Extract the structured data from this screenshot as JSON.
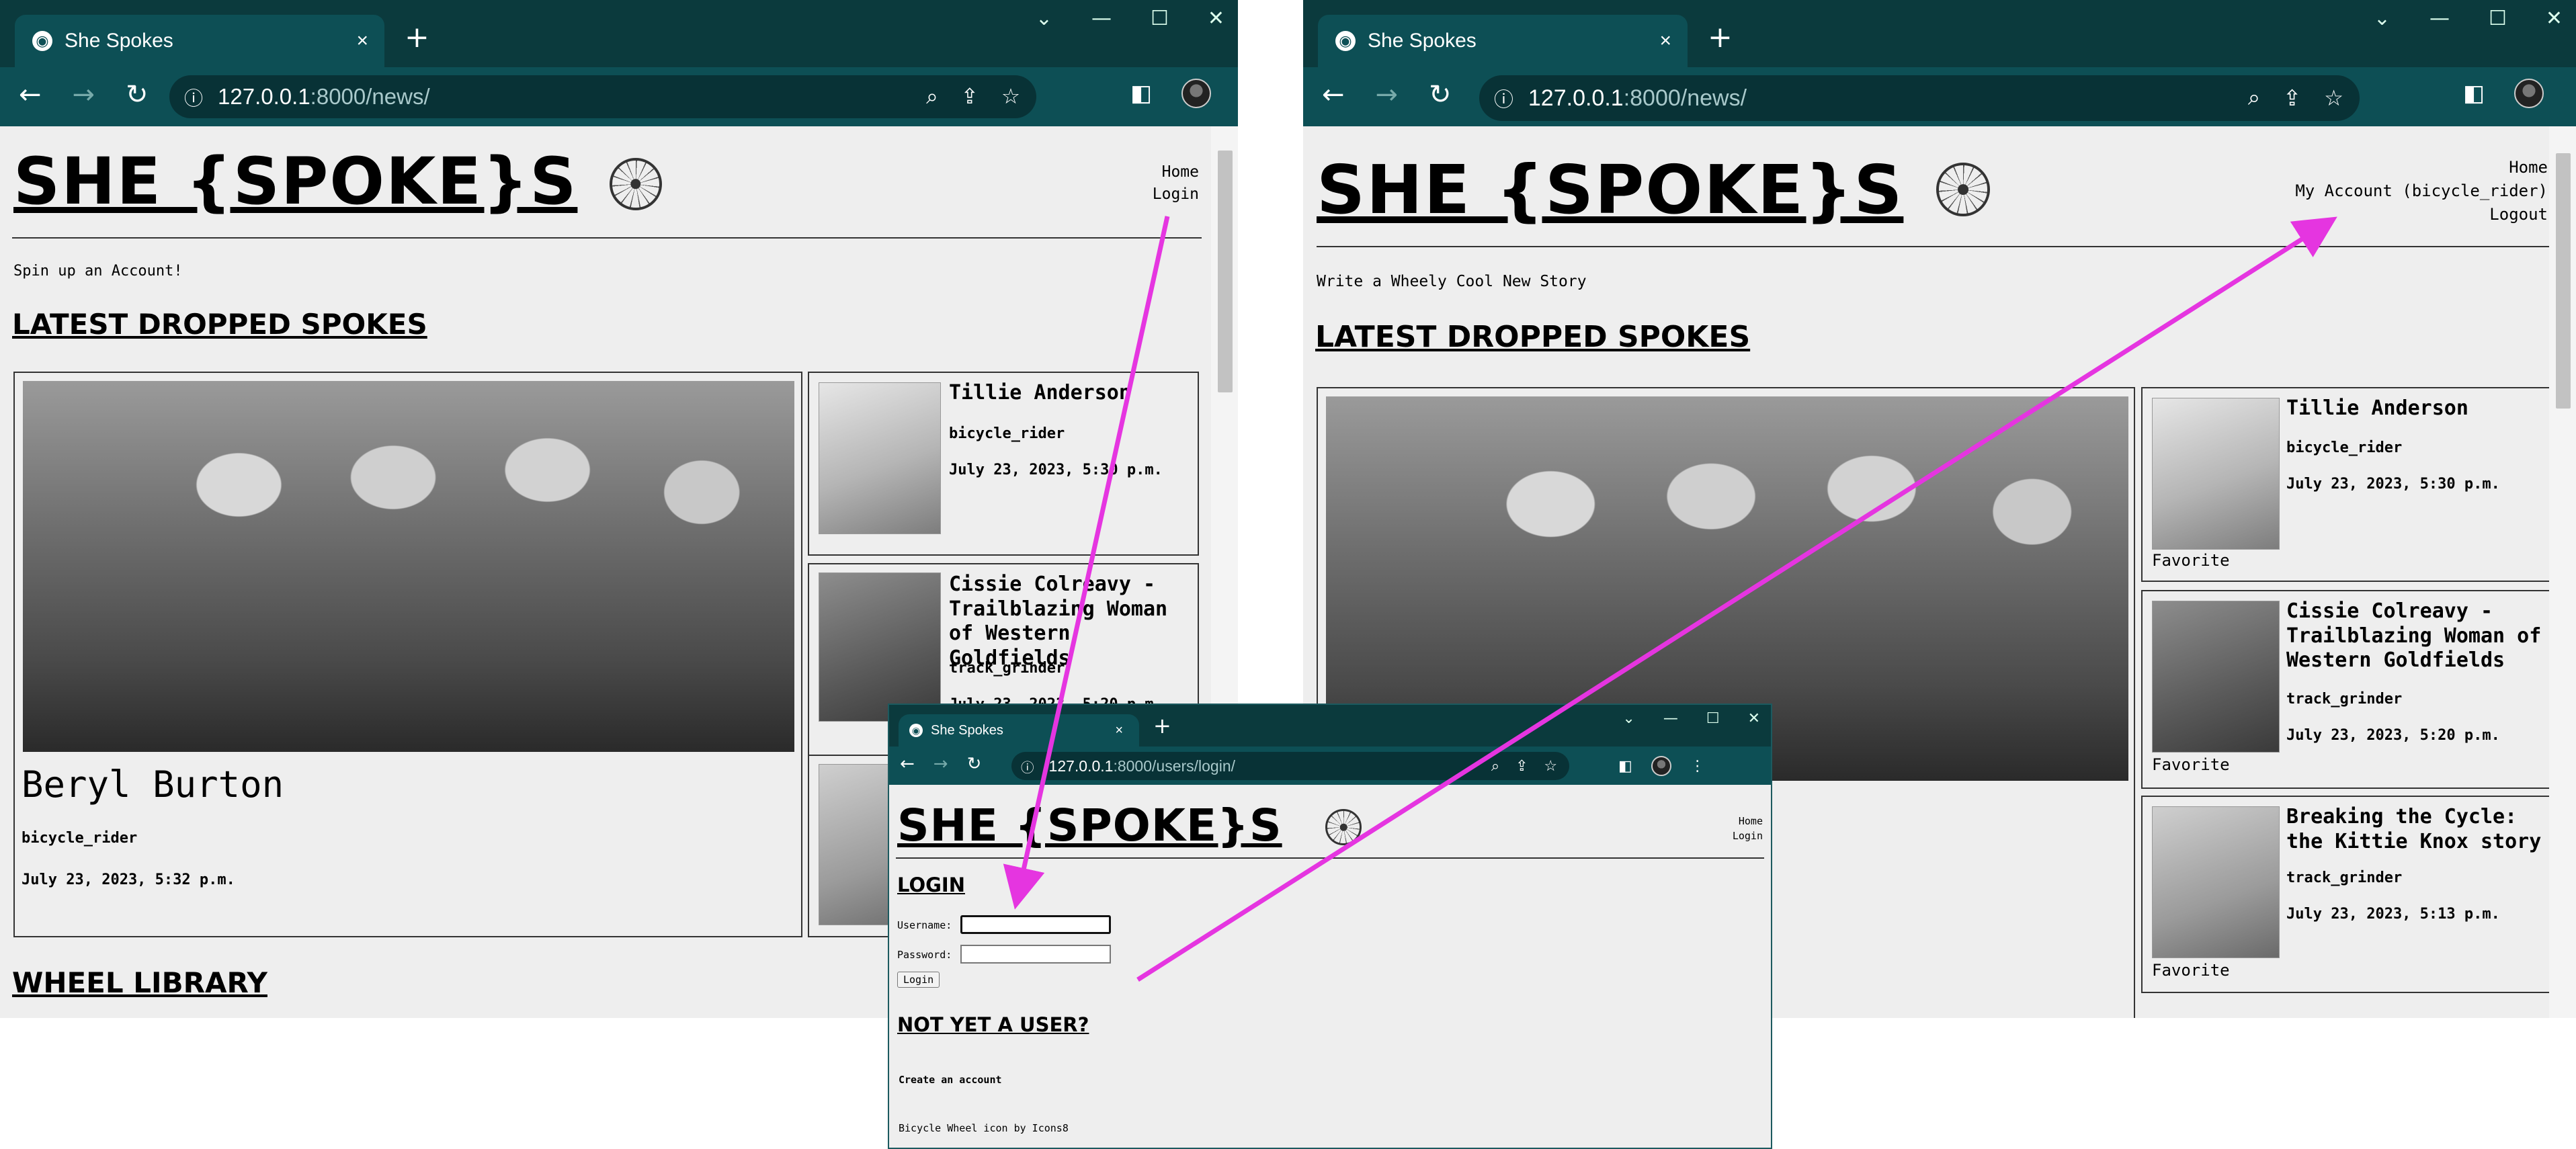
{
  "browser": {
    "tab_title": "She Spokes",
    "tab_close": "×",
    "new_tab": "+",
    "win_controls": [
      "⌄",
      "—",
      "☐",
      "✕"
    ],
    "url_host": "127.0.0.1",
    "news_path": ":8000/news/",
    "login_path": ":8000/users/login/"
  },
  "site": {
    "brand": "SHE {SPOKE}S",
    "latest_heading": "LATEST DROPPED SPOKES",
    "library_heading": "WHEEL LIBRARY",
    "nav_home": "Home",
    "nav_login": "Login",
    "nav_account": "My Account (bicycle_rider)",
    "nav_logout": "Logout"
  },
  "logged_out": {
    "cta": "Spin up an Account!",
    "featured": {
      "title": "Beryl Burton",
      "author": "bicycle_rider",
      "date": "July 23, 2023, 5:32 p.m."
    },
    "cards": [
      {
        "title": "Tillie Anderson",
        "author": "bicycle_rider",
        "date": "July 23, 2023, 5:30 p.m."
      },
      {
        "title": "Cissie Colreavy - Trailblazing Woman of Western Goldfields",
        "author": "track_grinder",
        "date": "July 23, 2023, 5:20 p.m."
      }
    ]
  },
  "logged_in": {
    "cta": "Write a Wheely Cool New Story",
    "cards": [
      {
        "title": "Tillie Anderson",
        "author": "bicycle_rider",
        "date": "July 23, 2023, 5:30 p.m.",
        "action": "Favorite"
      },
      {
        "title": "Cissie Colreavy - Trailblazing Woman of Western Goldfields",
        "author": "track_grinder",
        "date": "July 23, 2023, 5:20 p.m.",
        "action": "Favorite"
      },
      {
        "title": "Breaking the Cycle: the Kittie Knox story",
        "author": "track_grinder",
        "date": "July 23, 2023, 5:13 p.m.",
        "action": "Favorite"
      }
    ]
  },
  "login_page": {
    "heading": "LOGIN",
    "username_label": "Username:",
    "password_label": "Password:",
    "button": "Login",
    "signup_heading": "NOT YET A USER?",
    "signup_link": "Create an account",
    "footer": "Bicycle Wheel icon by Icons8"
  },
  "colors": {
    "chrome_dark": "#0b3a3d",
    "chrome": "#0d4f55",
    "page_bg": "#eeeeee",
    "annotation_arrow": "#e535e0"
  },
  "icons": [
    "globe-icon",
    "back-icon",
    "forward-icon",
    "reload-icon",
    "info-icon",
    "zoom-icon",
    "share-icon",
    "star-icon",
    "sidepanel-icon",
    "profile-avatar",
    "menu-icon",
    "bicycle-wheel-icon"
  ]
}
